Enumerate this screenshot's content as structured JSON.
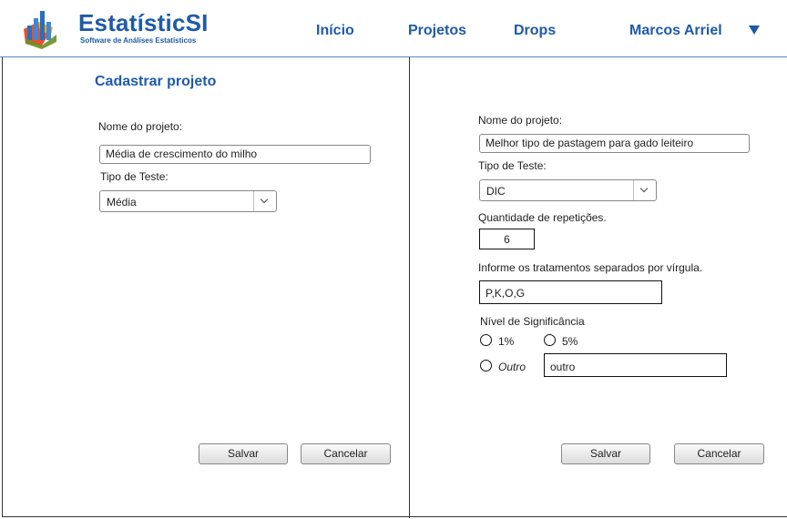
{
  "header": {
    "brand": "EstatísticSI",
    "brand_subtitle": "Software de Análises Estatísticos",
    "nav": {
      "inicio": "Início",
      "projetos": "Projetos",
      "drops": "Drops",
      "user": "Marcos Arriel"
    }
  },
  "left_form": {
    "title": "Cadastrar projeto",
    "name_label": "Nome do projeto:",
    "name_value": "Média de crescimento do milho",
    "type_label": "Tipo de Teste:",
    "type_value": "Média",
    "save": "Salvar",
    "cancel": "Cancelar"
  },
  "right_form": {
    "name_label": "Nome do projeto:",
    "name_value": "Melhor tipo de pastagem para gado leiteiro",
    "type_label": "Tipo de Teste:",
    "type_value": "DIC",
    "reps_label": "Quantidade de repetições.",
    "reps_value": "6",
    "treat_label": "Informe os tratamentos separados por vírgula.",
    "treat_value": "P,K,O,G",
    "sig_label": "Nível de Significância",
    "opt_1": "1%",
    "opt_5": "5%",
    "opt_other": "Outro",
    "other_value": "outro",
    "save": "Salvar",
    "cancel": "Cancelar"
  }
}
